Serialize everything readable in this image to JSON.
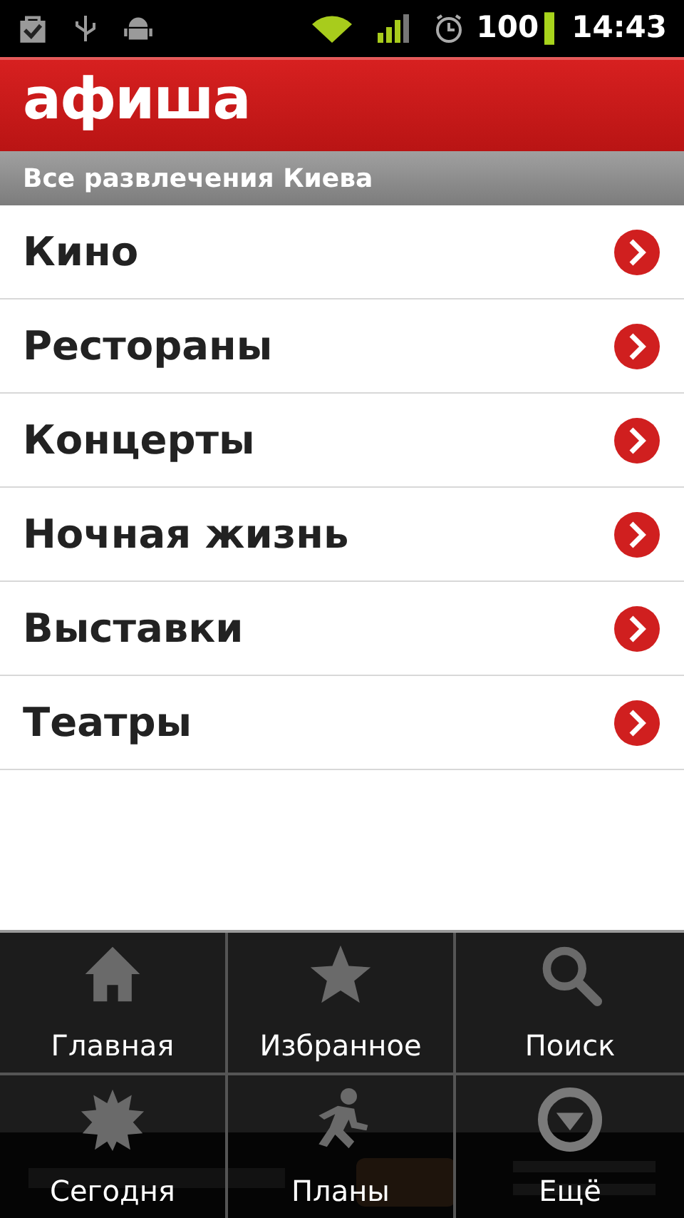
{
  "status_bar": {
    "battery": "100",
    "time": "14:43"
  },
  "header": {
    "logo": "афиша"
  },
  "section_title": "Все развлечения Киева",
  "categories": [
    {
      "label": "Кино"
    },
    {
      "label": "Рестораны"
    },
    {
      "label": "Концерты"
    },
    {
      "label": "Ночная жизнь"
    },
    {
      "label": "Выставки"
    },
    {
      "label": "Театры"
    }
  ],
  "menu": [
    {
      "label": "Главная"
    },
    {
      "label": "Избранное"
    },
    {
      "label": "Поиск"
    },
    {
      "label": "Сегодня"
    },
    {
      "label": "Планы"
    },
    {
      "label": "Ещё"
    }
  ]
}
